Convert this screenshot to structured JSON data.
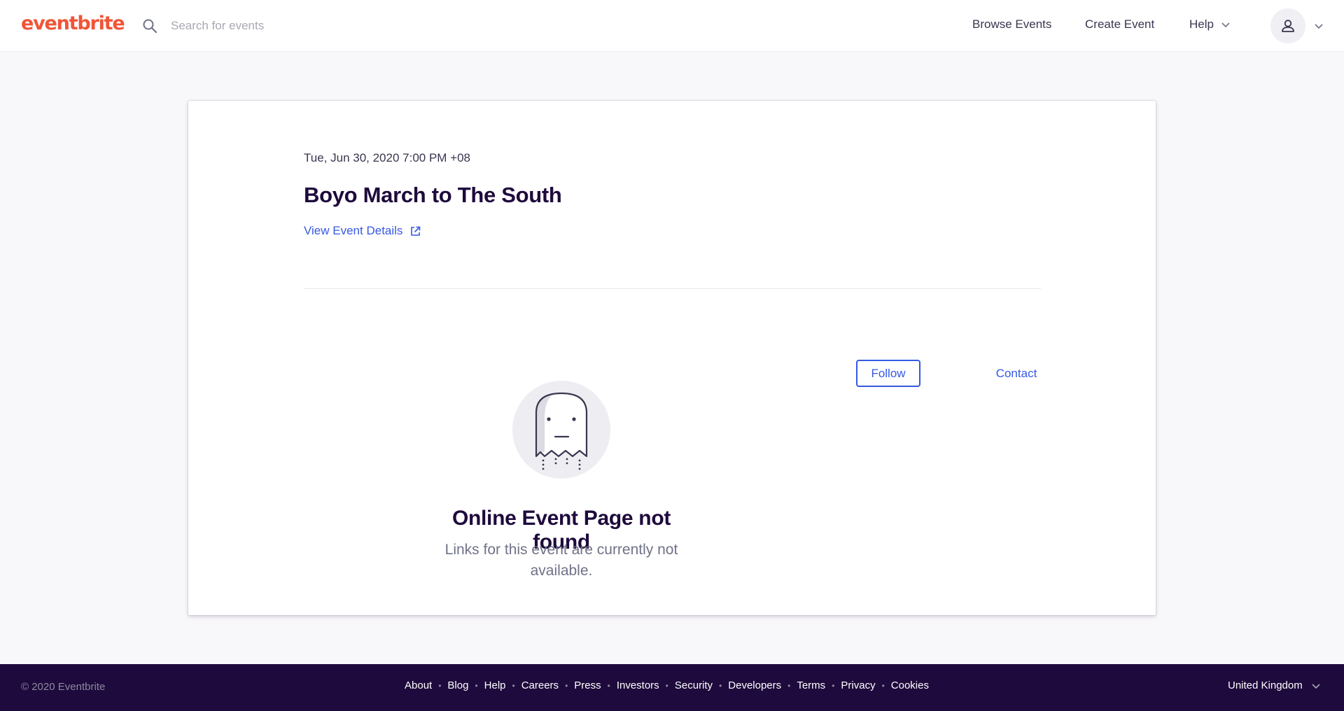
{
  "header": {
    "logo_text": "eventbrite",
    "search_placeholder": "Search for events",
    "nav": {
      "browse": "Browse Events",
      "create": "Create Event",
      "help": "Help"
    }
  },
  "event": {
    "date": "Tue, Jun 30, 2020 7:00 PM +08",
    "title": "Boyo March to The South",
    "details_link": "View Event Details",
    "follow_label": "Follow",
    "contact_label": "Contact"
  },
  "not_found": {
    "title": "Online Event Page not found",
    "subtitle": "Links for this event are currently not available."
  },
  "footer": {
    "copyright": "© 2020 Eventbrite",
    "links": [
      "About",
      "Blog",
      "Help",
      "Careers",
      "Press",
      "Investors",
      "Security",
      "Developers",
      "Terms",
      "Privacy",
      "Cookies"
    ],
    "country": "United Kingdom"
  },
  "colors": {
    "brand": "#f05537",
    "link": "#3659e3",
    "footer_bg": "#1e0a3c",
    "page_bg": "#f8f7fa"
  }
}
